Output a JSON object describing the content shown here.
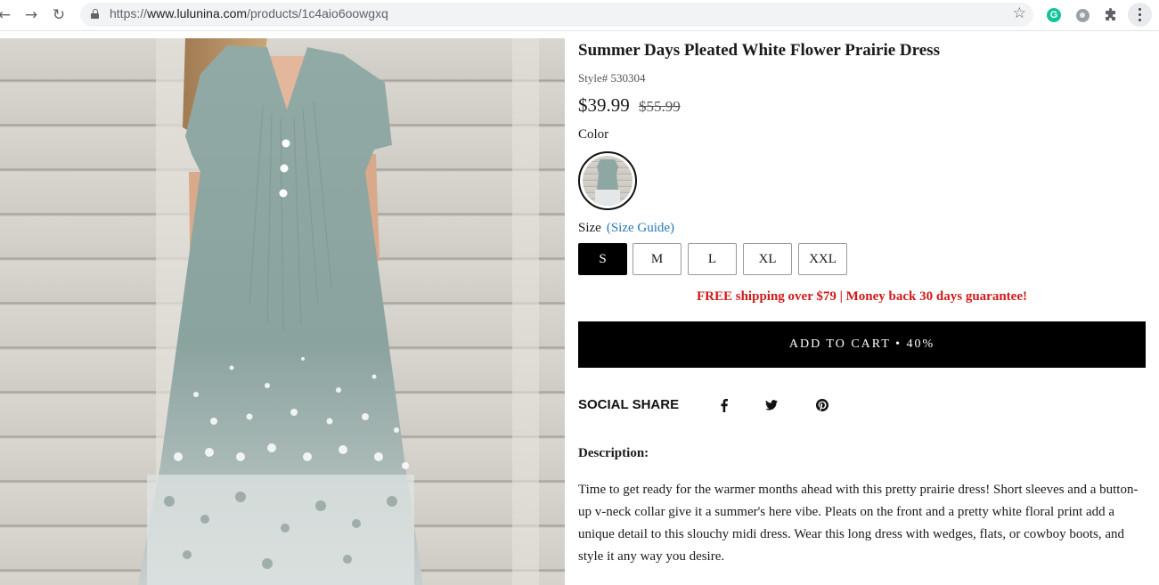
{
  "browser": {
    "url_prefix": "https://",
    "url_domain": "www.lulunina.com",
    "url_path": "/products/1c4aio6oowgxq",
    "back_icon": "arrow-left-icon",
    "forward_icon": "arrow-right-icon",
    "reload_icon": "reload-icon",
    "extension_g_label": "G",
    "extensions": [
      "grammarly-icon",
      "circle-extension-icon",
      "puzzle-icon",
      "kebab-menu-icon"
    ]
  },
  "product": {
    "title": "Summer Days Pleated White Flower Prairie Dress",
    "style_number": "Style# 530304",
    "price": "$39.99",
    "original_price": "$55.99",
    "color_label": "Color",
    "size_label": "Size",
    "size_guide_label": "(Size Guide)",
    "sizes": [
      "S",
      "M",
      "L",
      "XL",
      "XXL"
    ],
    "selected_size": "S",
    "shipping_notice": "FREE shipping over $79 | Money back 30 days guarantee!",
    "add_to_cart_label": "ADD TO CART • 40%",
    "social_share_label": "SOCIAL SHARE",
    "social_icons": [
      "facebook-icon",
      "twitter-icon",
      "pinterest-icon"
    ],
    "description_label": "Description:",
    "description_text": "Time to get ready for the warmer months ahead with this pretty prairie dress! Short sleeves and a button-up v-neck collar give it a summer's here vibe. Pleats on the front and a pretty white floral print add a unique detail to this slouchy midi dress. Wear this long dress with wedges, flats, or cowboy boots, and style it any way you desire."
  },
  "colors": {
    "dress": "#8fa7a3",
    "accent_red": "#d11a1a",
    "link_blue": "#2a7ab5",
    "cart_button": "#000000"
  }
}
